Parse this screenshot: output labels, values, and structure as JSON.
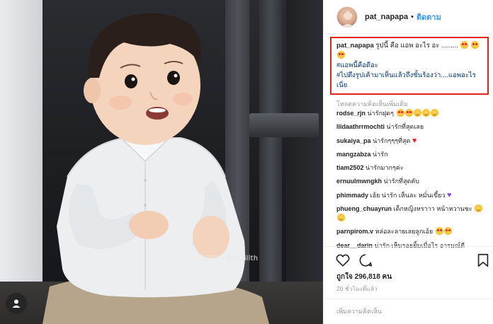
{
  "photo": {
    "watermark": "EDIT : @dr.jillth"
  },
  "header": {
    "username": "pat_napapa",
    "separator": "•",
    "follow_label": "ติดตาม"
  },
  "caption": {
    "username": "pat_napapa",
    "text": "รูปนี้ คือ แอพ อะไร อะ .........",
    "hashtag_1": "#แอพนี้คือดีอะ",
    "hashtag_2": "#ไปดึงรูปเค้ามาเห็นแล้วถึงขั้นร้องว่า....แอพอะไรเนี่ย"
  },
  "load_more": "โหลดความคิดเห็นเพิ่มเติม",
  "comments": [
    {
      "user": "rodse_rjn",
      "text": "น่ารักฝุดๆ"
    },
    {
      "user": "llidaathrrmochti",
      "text": "น่ารักที่สุดเลย"
    },
    {
      "user": "sukaiya_pa",
      "text": "น่ารักๆๆๆที่สุด"
    },
    {
      "user": "mangzabza",
      "text": "น่ารัก"
    },
    {
      "user": "tiam2502",
      "text": "น่ารักมากๆค่ะ"
    },
    {
      "user": "ernuulmwngkh",
      "text": "น่ารักที่สุดคับ"
    },
    {
      "user": "phimmady",
      "text": "เฮ้ย น่ารัก เห็นละ หมั่นเขี้ยว"
    },
    {
      "user": "phueng_chuayrun",
      "text": "เด็กหญิงหราาา หน้าหวานชะ"
    },
    {
      "user": "parnpirom.v",
      "text": "หล่อละลายเลยลูกเอ้ย"
    },
    {
      "user": "dear__darin",
      "text": "น่ารัก เห็นรอยยิ้มเมื่อไร อารมณ์ดี"
    }
  ],
  "likes": "ถูกใจ 296,818 คน",
  "timestamp": "20 ชั่วโมงที่แล้ว",
  "add_comment_placeholder": "เพิ่มความคิดเห็น",
  "icons": [
    "heart-icon",
    "comment-icon",
    "bookmark-icon",
    "user-tag-icon"
  ],
  "colors": {
    "link": "#3897f0",
    "hashtag": "#003569",
    "highlight_box": "#e2231a",
    "muted": "#999999"
  }
}
